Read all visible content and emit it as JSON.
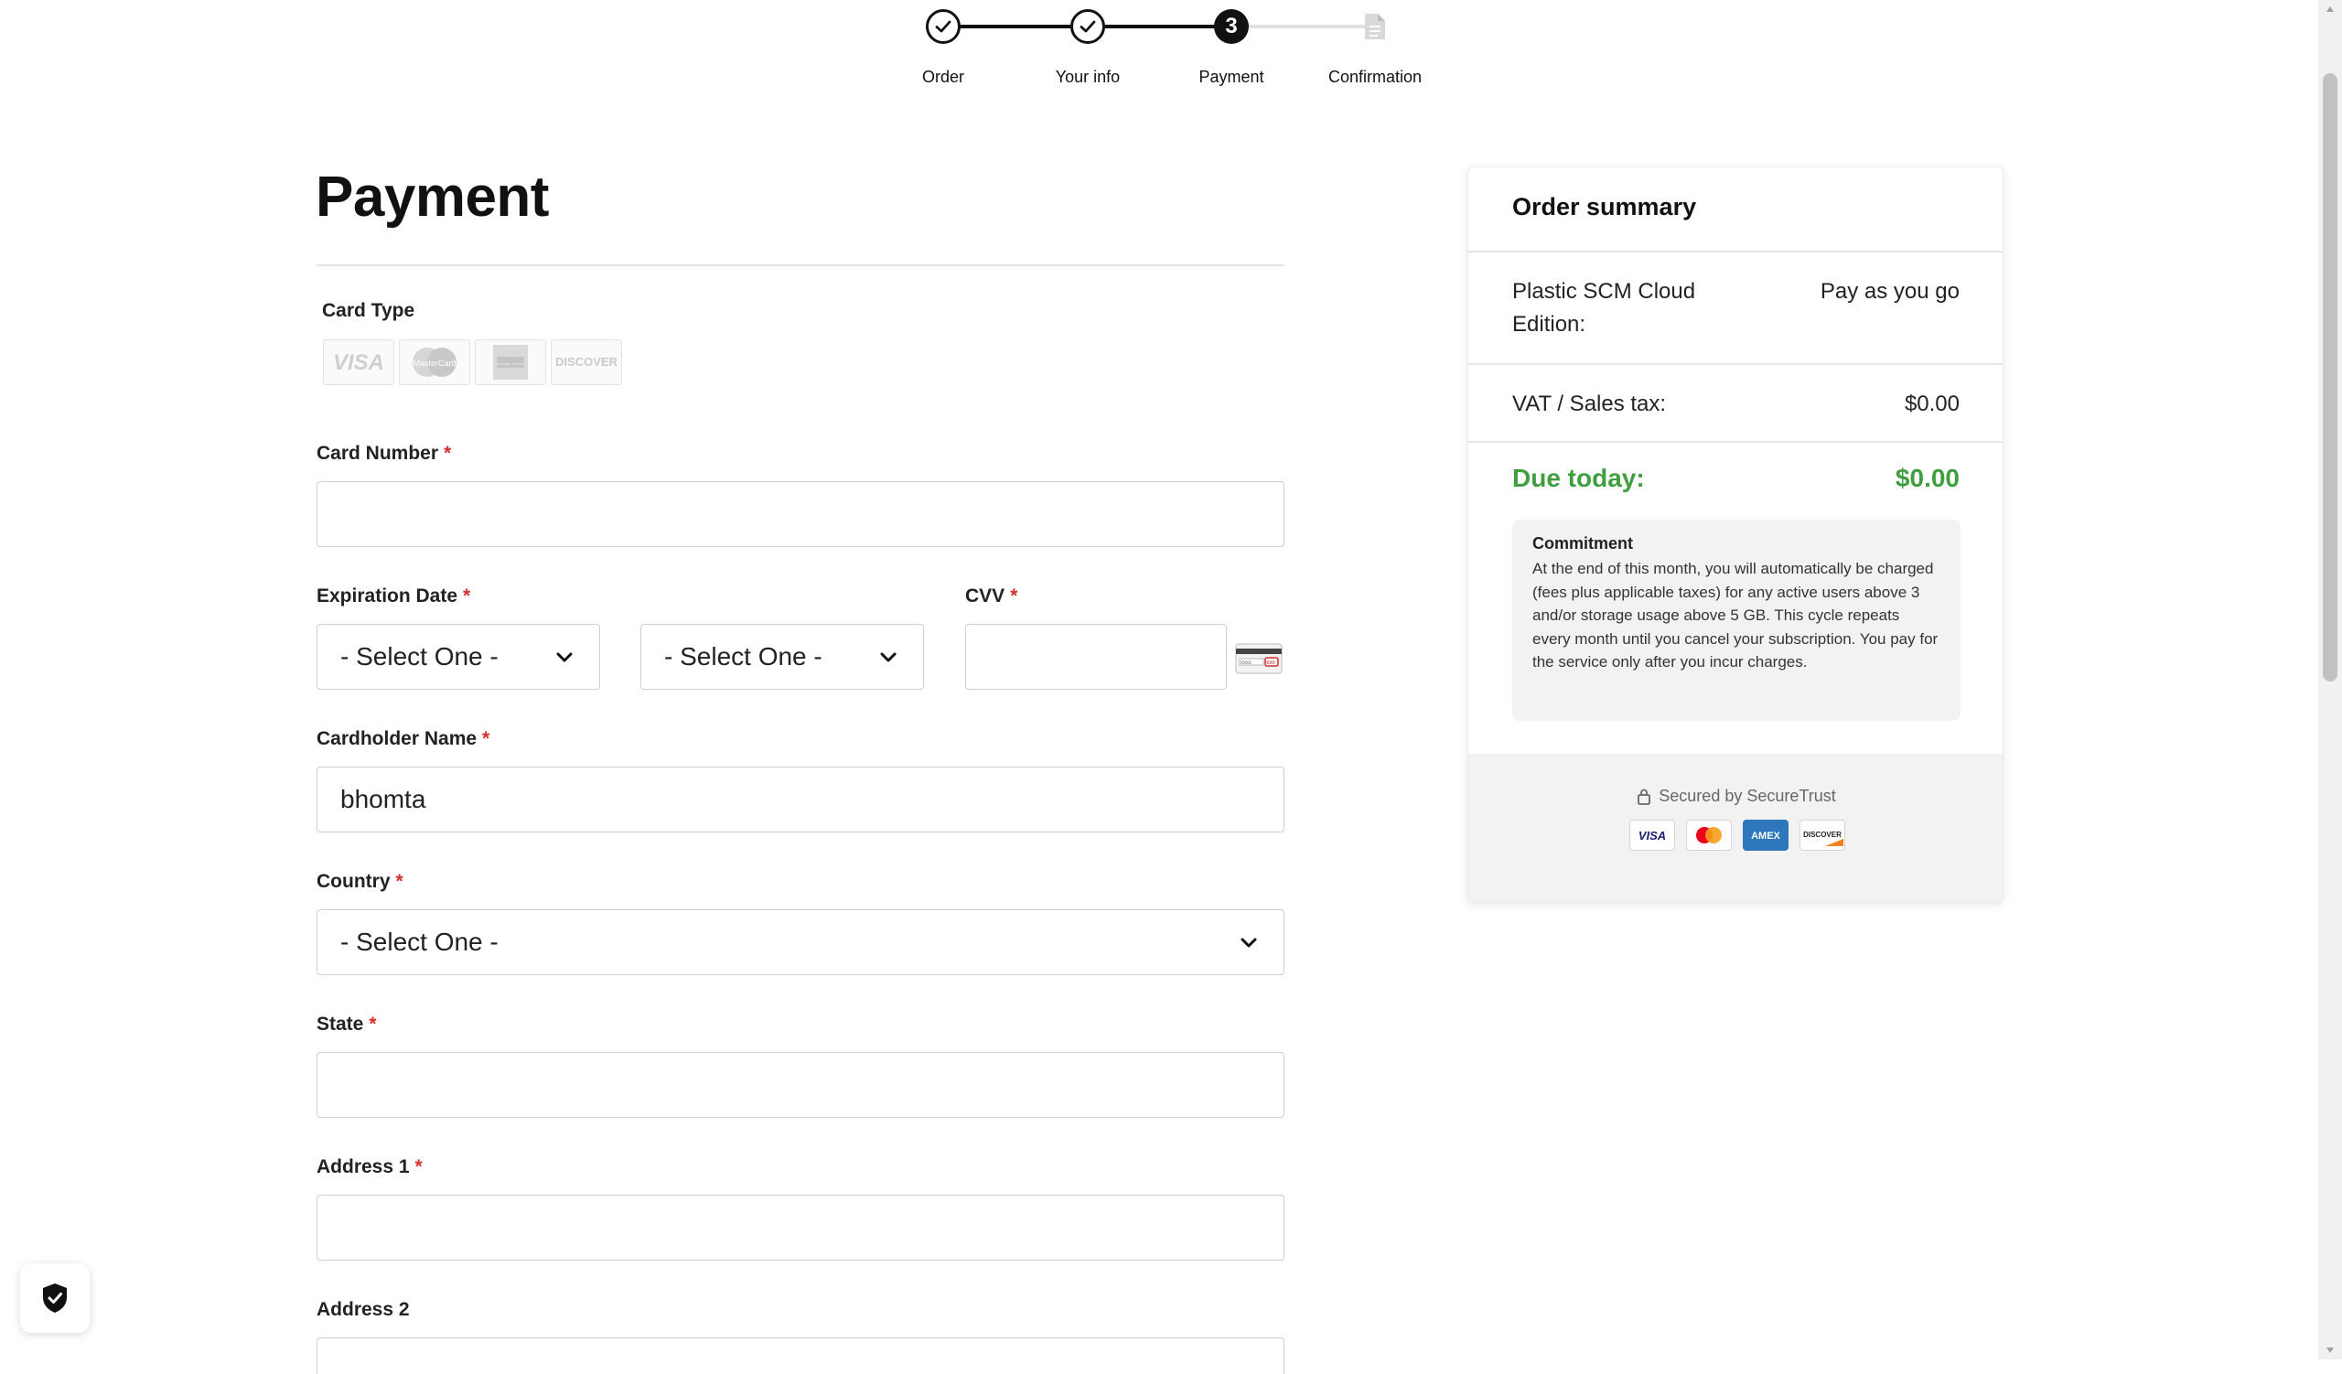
{
  "stepper": {
    "steps": [
      {
        "label": "Order",
        "state": "done"
      },
      {
        "label": "Your info",
        "state": "done"
      },
      {
        "label": "Payment",
        "state": "current",
        "number": "3"
      },
      {
        "label": "Confirmation",
        "state": "pending"
      }
    ]
  },
  "form": {
    "title": "Payment",
    "card_type_label": "Card Type",
    "card_types": [
      "VISA",
      "MasterCard",
      "American Express",
      "DISCOVER"
    ],
    "card_number": {
      "label": "Card Number",
      "required_mark": "*",
      "value": ""
    },
    "expiration": {
      "label": "Expiration Date",
      "required_mark": "*",
      "month_value": "- Select One -",
      "year_value": "- Select One -"
    },
    "cvv": {
      "label": "CVV",
      "required_mark": "*",
      "value": "",
      "icon": "card-back-icon"
    },
    "cardholder": {
      "label": "Cardholder Name",
      "required_mark": "*",
      "value": "bhomta"
    },
    "country": {
      "label": "Country",
      "required_mark": "*",
      "value": "- Select One -"
    },
    "state": {
      "label": "State",
      "required_mark": "*",
      "value": ""
    },
    "address1": {
      "label": "Address 1",
      "required_mark": "*",
      "value": ""
    },
    "address2": {
      "label": "Address 2",
      "value": ""
    }
  },
  "summary": {
    "title": "Order summary",
    "product_name": "Plastic SCM Cloud Edition:",
    "product_plan": "Pay as you go",
    "tax_label": "VAT / Sales tax:",
    "tax_value": "$0.00",
    "due_label": "Due today:",
    "due_value": "$0.00",
    "commitment_title": "Commitment",
    "commitment_text": "At the end of this month, you will automatically be charged (fees plus applicable taxes) for any active users above 3 and/or storage usage above 5 GB. This cycle repeats every month until you cancel your subscription. You pay for the service only after you incur charges.",
    "secured_text": "Secured by SecureTrust",
    "payment_logos": [
      "VISA",
      "MasterCard",
      "AMEX",
      "DISCOVER"
    ]
  },
  "colors": {
    "accent_green": "#3f9f3f",
    "required_red": "#d32f2f",
    "stepper_active": "#111111",
    "stepper_inactive": "#e0e0e0"
  },
  "icons": [
    "check-icon",
    "document-icon",
    "chevron-down-icon",
    "lock-icon",
    "shield-check-icon"
  ]
}
